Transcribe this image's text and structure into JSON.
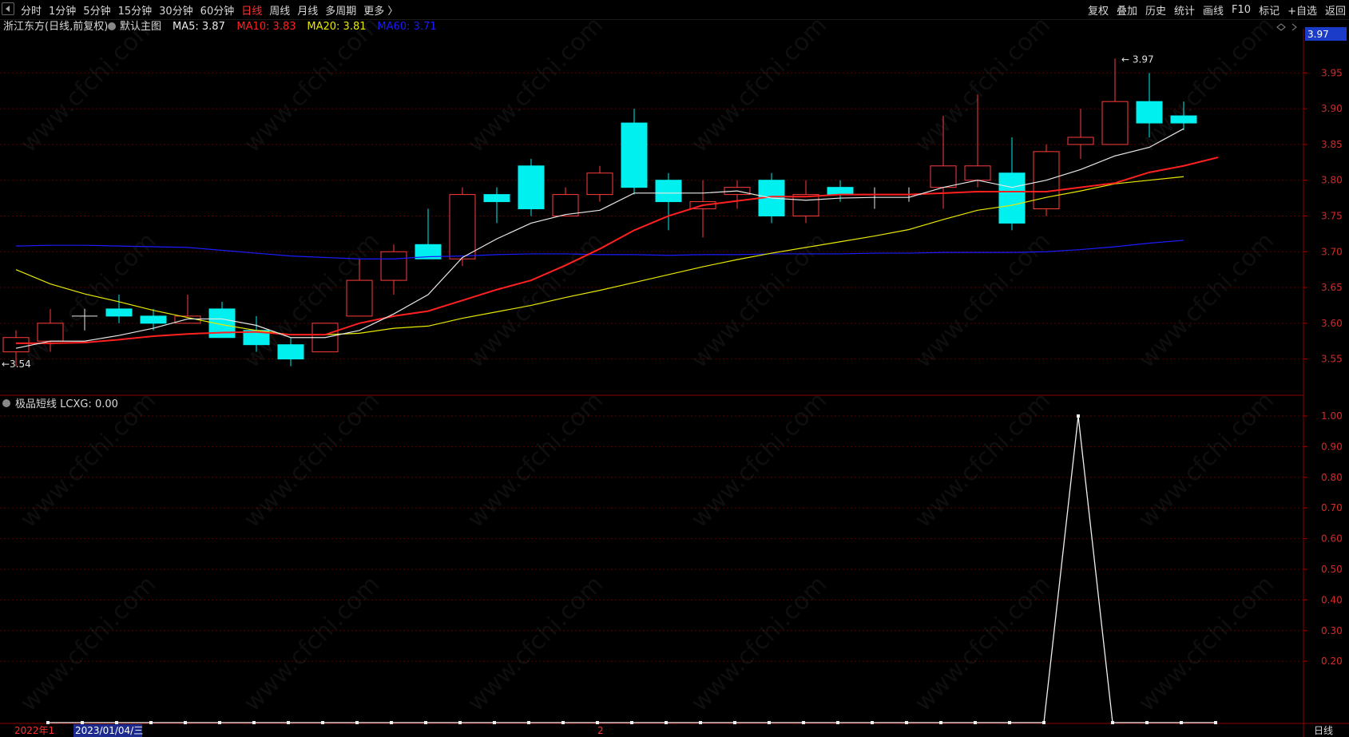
{
  "toolbar": {
    "tabs": [
      "分时",
      "1分钟",
      "5分钟",
      "15分钟",
      "30分钟",
      "60分钟",
      "日线",
      "周线",
      "月线",
      "多周期",
      "更多 〉"
    ],
    "active_tab": "日线",
    "tools": [
      "复权",
      "叠加",
      "历史",
      "统计",
      "画线",
      "F10",
      "标记",
      "+自选",
      "返回"
    ]
  },
  "main_panel": {
    "stock": "浙江东方(日线,前复权)",
    "template_label": "默认主图",
    "ma": [
      {
        "label": "MA5: 3.87",
        "color": "#e8e8e8"
      },
      {
        "label": "MA10: 3.83",
        "color": "#ff2020"
      },
      {
        "label": "MA20: 3.81",
        "color": "#e8e800"
      },
      {
        "label": "MA60: 3.71",
        "color": "#1a1aff"
      }
    ],
    "price_badge": "3.97",
    "high_label": "3.97",
    "low_label": "3.54",
    "y_ticks": [
      "3.95",
      "3.90",
      "3.85",
      "3.80",
      "3.75",
      "3.70",
      "3.65",
      "3.60",
      "3.55"
    ]
  },
  "sub_panel": {
    "indicator": "极品短线 LCXG: 0.00",
    "y_ticks": [
      "1.00",
      "0.90",
      "0.80",
      "0.70",
      "0.60",
      "0.50",
      "0.40",
      "0.30",
      "0.20"
    ]
  },
  "bottom": {
    "year_label": "2022年1",
    "date_label": "2023/01/04/三",
    "mid_marker": "2",
    "period_label": "日线"
  },
  "watermark_text": "www.cfchi.com",
  "chart_data": {
    "type": "candlestick",
    "candles": [
      {
        "o": 3.56,
        "h": 3.59,
        "l": 3.54,
        "c": 3.58
      },
      {
        "o": 3.575,
        "h": 3.62,
        "l": 3.56,
        "c": 3.6
      },
      {
        "o": 3.61,
        "h": 3.62,
        "l": 3.59,
        "c": 3.61
      },
      {
        "o": 3.62,
        "h": 3.64,
        "l": 3.6,
        "c": 3.61
      },
      {
        "o": 3.61,
        "h": 3.62,
        "l": 3.59,
        "c": 3.6
      },
      {
        "o": 3.6,
        "h": 3.64,
        "l": 3.6,
        "c": 3.61
      },
      {
        "o": 3.62,
        "h": 3.63,
        "l": 3.58,
        "c": 3.58
      },
      {
        "o": 3.59,
        "h": 3.61,
        "l": 3.56,
        "c": 3.57
      },
      {
        "o": 3.57,
        "h": 3.58,
        "l": 3.54,
        "c": 3.55
      },
      {
        "o": 3.56,
        "h": 3.6,
        "l": 3.56,
        "c": 3.6
      },
      {
        "o": 3.61,
        "h": 3.69,
        "l": 3.61,
        "c": 3.66
      },
      {
        "o": 3.66,
        "h": 3.71,
        "l": 3.64,
        "c": 3.7
      },
      {
        "o": 3.71,
        "h": 3.76,
        "l": 3.69,
        "c": 3.69
      },
      {
        "o": 3.69,
        "h": 3.79,
        "l": 3.68,
        "c": 3.78
      },
      {
        "o": 3.78,
        "h": 3.79,
        "l": 3.74,
        "c": 3.77
      },
      {
        "o": 3.82,
        "h": 3.83,
        "l": 3.75,
        "c": 3.76
      },
      {
        "o": 3.75,
        "h": 3.79,
        "l": 3.75,
        "c": 3.78
      },
      {
        "o": 3.78,
        "h": 3.82,
        "l": 3.77,
        "c": 3.81
      },
      {
        "o": 3.88,
        "h": 3.9,
        "l": 3.78,
        "c": 3.79
      },
      {
        "o": 3.8,
        "h": 3.81,
        "l": 3.73,
        "c": 3.77
      },
      {
        "o": 3.76,
        "h": 3.8,
        "l": 3.72,
        "c": 3.77
      },
      {
        "o": 3.78,
        "h": 3.8,
        "l": 3.76,
        "c": 3.79
      },
      {
        "o": 3.8,
        "h": 3.81,
        "l": 3.74,
        "c": 3.75
      },
      {
        "o": 3.75,
        "h": 3.8,
        "l": 3.74,
        "c": 3.78
      },
      {
        "o": 3.79,
        "h": 3.8,
        "l": 3.77,
        "c": 3.78
      },
      {
        "o": 3.78,
        "h": 3.79,
        "l": 3.76,
        "c": 3.78
      },
      {
        "o": 3.78,
        "h": 3.79,
        "l": 3.77,
        "c": 3.78
      },
      {
        "o": 3.79,
        "h": 3.89,
        "l": 3.76,
        "c": 3.82
      },
      {
        "o": 3.8,
        "h": 3.92,
        "l": 3.79,
        "c": 3.82
      },
      {
        "o": 3.81,
        "h": 3.86,
        "l": 3.73,
        "c": 3.74
      },
      {
        "o": 3.76,
        "h": 3.85,
        "l": 3.75,
        "c": 3.84
      },
      {
        "o": 3.85,
        "h": 3.9,
        "l": 3.83,
        "c": 3.86
      },
      {
        "o": 3.85,
        "h": 3.97,
        "l": 3.85,
        "c": 3.91
      },
      {
        "o": 3.91,
        "h": 3.95,
        "l": 3.86,
        "c": 3.88
      },
      {
        "o": 3.89,
        "h": 3.91,
        "l": 3.87,
        "c": 3.88
      }
    ],
    "ma5": [
      3.565,
      3.575,
      3.575,
      3.583,
      3.593,
      3.606,
      3.606,
      3.597,
      3.58,
      3.58,
      3.59,
      3.613,
      3.64,
      3.692,
      3.718,
      3.74,
      3.752,
      3.758,
      3.782,
      3.782,
      3.782,
      3.785,
      3.775,
      3.772,
      3.775,
      3.776,
      3.776,
      3.79,
      3.8,
      3.79,
      3.8,
      3.815,
      3.834,
      3.846,
      3.872
    ],
    "ma10": [
      3.572,
      3.572,
      3.573,
      3.577,
      3.582,
      3.585,
      3.587,
      3.588,
      3.584,
      3.584,
      3.6,
      3.61,
      3.617,
      3.632,
      3.647,
      3.66,
      3.681,
      3.704,
      3.73,
      3.75,
      3.765,
      3.771,
      3.777,
      3.777,
      3.78,
      3.78,
      3.78,
      3.782,
      3.784,
      3.784,
      3.784,
      3.79,
      3.796,
      3.811,
      3.82,
      3.832
    ],
    "ma20": [
      3.675,
      3.655,
      3.641,
      3.63,
      3.618,
      3.608,
      3.598,
      3.59,
      3.584,
      3.584,
      3.586,
      3.593,
      3.596,
      3.607,
      3.616,
      3.625,
      3.636,
      3.646,
      3.657,
      3.668,
      3.679,
      3.689,
      3.698,
      3.706,
      3.714,
      3.722,
      3.731,
      3.745,
      3.758,
      3.765,
      3.776,
      3.785,
      3.795,
      3.8,
      3.805
    ],
    "ma60": [
      3.708,
      3.709,
      3.709,
      3.708,
      3.707,
      3.706,
      3.702,
      3.698,
      3.694,
      3.692,
      3.69,
      3.69,
      3.693,
      3.694,
      3.696,
      3.697,
      3.697,
      3.696,
      3.696,
      3.695,
      3.696,
      3.696,
      3.697,
      3.697,
      3.697,
      3.698,
      3.698,
      3.699,
      3.699,
      3.699,
      3.7,
      3.703,
      3.707,
      3.712,
      3.716
    ],
    "lcxg": [
      0,
      0,
      0,
      0,
      0,
      0,
      0,
      0,
      0,
      0,
      0,
      0,
      0,
      0,
      0,
      0,
      0,
      0,
      0,
      0,
      0,
      0,
      0,
      0,
      0,
      0,
      0,
      0,
      0,
      0,
      1,
      0,
      0,
      0,
      0
    ],
    "price_range": [
      3.525,
      3.985
    ],
    "sub_range": [
      0,
      1.05
    ]
  }
}
